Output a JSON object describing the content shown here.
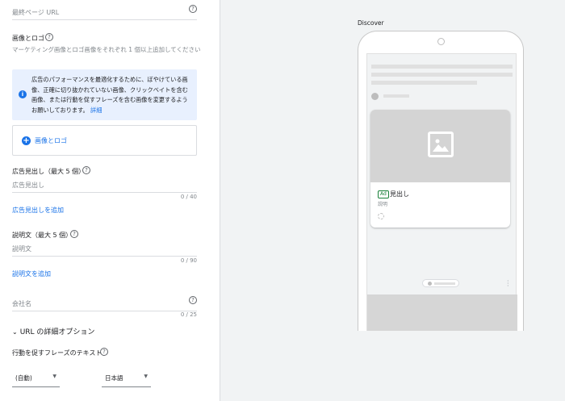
{
  "form": {
    "final_url_placeholder": "最終ページ URL",
    "images_title": "画像とロゴ",
    "images_desc": "マーケティング画像とロゴ画像をそれぞれ 1 個以上追加してください",
    "info_text": "広告のパフォーマンスを最適化するために、ぼやけている画像、正確に切り抜かれていない画像、クリックベイトを含む画像、または行動を促すフレーズを含む画像を変更するようお願いしております。",
    "info_link": "詳細",
    "add_images_label": "画像とロゴ",
    "headlines_title": "広告見出し（最大 5 個）",
    "headline_placeholder": "広告見出し",
    "headline_counter": "0 / 40",
    "add_headline_link": "広告見出しを追加",
    "descriptions_title": "説明文（最大 5 個）",
    "description_placeholder": "説明文",
    "description_counter": "0 / 90",
    "add_description_link": "説明文を追加",
    "company_placeholder": "会社名",
    "company_counter": "0 / 25",
    "url_options_label": "URL の詳細オプション",
    "cta_title": "行動を促すフレーズのテキスト",
    "cta_select": "(自動)",
    "language_select": "日本語"
  },
  "preview": {
    "label": "Discover",
    "ad_badge": "Ad",
    "headline": "見出し",
    "description": "説明"
  },
  "icons": {
    "help": "help-icon",
    "info": "info-icon",
    "add": "add-circle-icon",
    "image": "image-placeholder-icon",
    "chevron": "chevron-down-icon",
    "caret": "dropdown-caret-icon",
    "more": "more-vert-icon"
  },
  "colors": {
    "accent": "#1a73e8",
    "info_bg": "#e8f0fe",
    "ad_badge": "#188038"
  }
}
